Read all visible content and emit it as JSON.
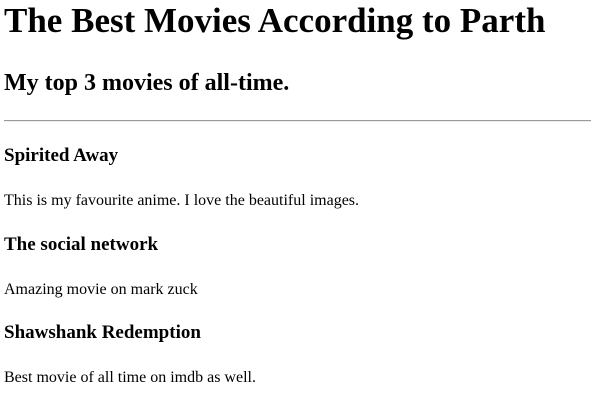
{
  "page": {
    "heading": "The Best Movies According to Parth",
    "subheading": "My top 3 movies of all-time."
  },
  "movies": [
    {
      "title": "Spirited Away",
      "description": "This is my favourite anime. I love the beautiful images."
    },
    {
      "title": "The social network",
      "description": "Amazing movie on mark zuck"
    },
    {
      "title": "Shawshank Redemption",
      "description": "Best movie of all time on imdb as well."
    }
  ]
}
